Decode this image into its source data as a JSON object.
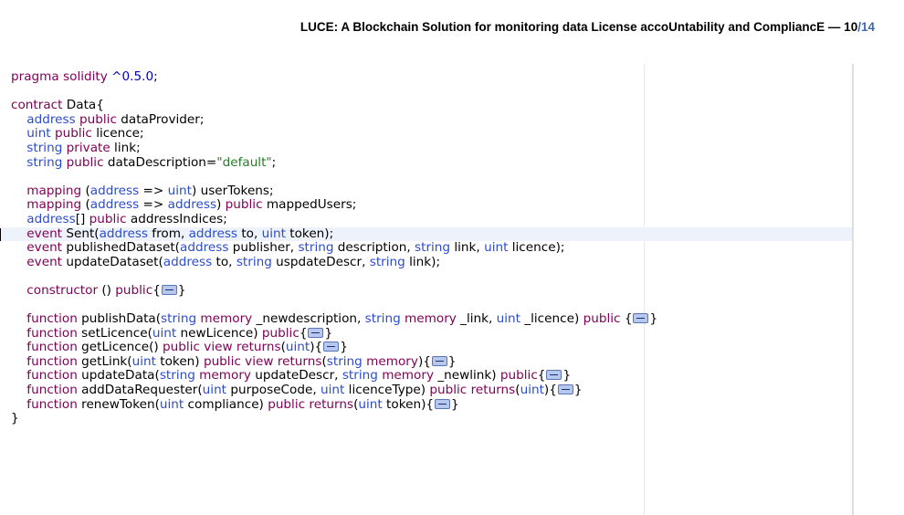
{
  "header": {
    "title": "LUCE: A Blockchain Solution for monitoring data License accoUntability and CompliancE — 10",
    "sep": "/",
    "page_total": "14"
  },
  "editor": {
    "fold_icon": "fold-collapse-icon",
    "colors": {
      "keyword": "#7f0055",
      "type": "#2b4ccc",
      "string": "#2a7a2a",
      "number": "#0000c0",
      "current_line": "#eef2fb"
    },
    "lines": [
      {
        "t": "pragma solidity ^0.5.0;"
      },
      {
        "t": ""
      },
      {
        "t": "contract Data{"
      },
      {
        "t": "    address public dataProvider;"
      },
      {
        "t": "    uint public licence;"
      },
      {
        "t": "    string private link;"
      },
      {
        "t": "    string public dataDescription=\"default\";"
      },
      {
        "t": ""
      },
      {
        "t": "    mapping (address => uint) userTokens;"
      },
      {
        "t": "    mapping (address => address) public mappedUsers;"
      },
      {
        "t": "    address[] public addressIndices;"
      },
      {
        "t": "    event Sent(address from, address to, uint token);",
        "current": true
      },
      {
        "t": "    event publishedDataset(address publisher, string description, string link, uint licence);"
      },
      {
        "t": "    event updateDataset(address to, string uspdateDescr, string link);"
      },
      {
        "t": ""
      },
      {
        "t": "    constructor () public{",
        "fold": true,
        "after": "}"
      },
      {
        "t": ""
      },
      {
        "t": "    function publishData(string memory _newdescription, string memory _link, uint _licence) public {",
        "fold": true,
        "after": "}"
      },
      {
        "t": "    function setLicence(uint newLicence) public{",
        "fold": true,
        "after": "}"
      },
      {
        "t": "    function getLicence() public view returns(uint){",
        "fold": true,
        "after": "}"
      },
      {
        "t": "    function getLink(uint token) public view returns(string memory){",
        "fold": true,
        "after": "}"
      },
      {
        "t": "    function updateData(string memory updateDescr, string memory _newlink) public{",
        "fold": true,
        "after": "}"
      },
      {
        "t": "    function addDataRequester(uint purposeCode, uint licenceType) public returns(uint){",
        "fold": true,
        "after": "}"
      },
      {
        "t": "    function renewToken(uint compliance) public returns(uint token){",
        "fold": true,
        "after": "}"
      },
      {
        "t": "}"
      }
    ]
  }
}
